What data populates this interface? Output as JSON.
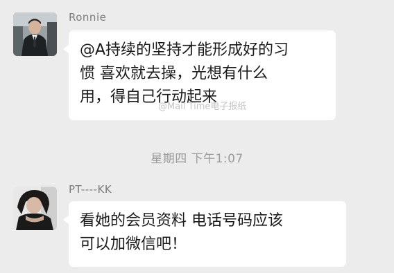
{
  "messages": [
    {
      "sender": "Ronnie",
      "lines": [
        "@A持续的坚持才能形成好的习",
        "惯 喜欢就去操，光想有什么",
        "用，得自己行动起来"
      ]
    },
    {
      "sender": "PT----KK",
      "lines": [
        "看她的会员资料 电话号码应该",
        "可以加微信吧！"
      ]
    }
  ],
  "timestamp": "星期四 下午1:07",
  "watermark": "@Mail Time电子报纸",
  "colors": {
    "background": "#ececec",
    "bubble": "#ffffff",
    "sender_text": "#7b7b7b",
    "timestamp_text": "#9b9b9b"
  }
}
